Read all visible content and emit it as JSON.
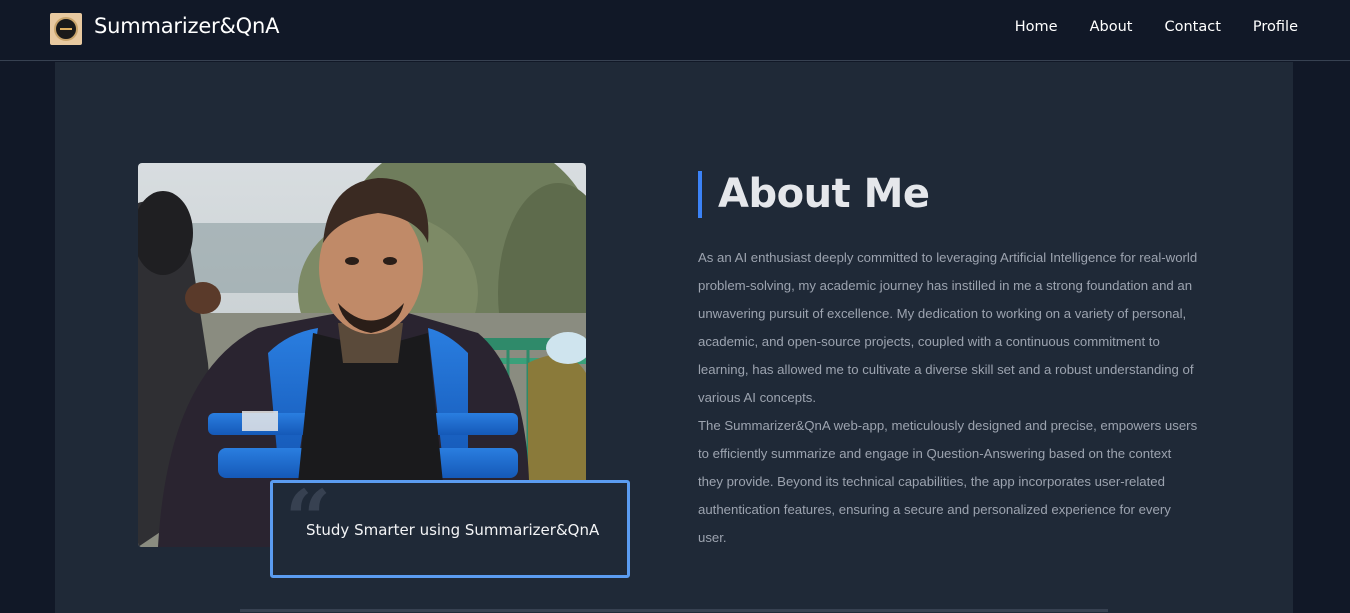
{
  "navbar": {
    "brand": "Summarizer&QnA",
    "links": [
      "Home",
      "About",
      "Contact",
      "Profile"
    ]
  },
  "about": {
    "heading": "About Me",
    "paragraph1": "As an AI enthusiast deeply committed to leveraging Artificial Intelligence for real-world problem-solving, my academic journey has instilled in me a strong foundation and an unwavering pursuit of excellence. My dedication to working on a variety of personal, academic, and open-source projects, coupled with a continuous commitment to learning, has allowed me to cultivate a diverse skill set and a robust understanding of various AI concepts.",
    "paragraph2": "The Summarizer&QnA web-app, meticulously designed and precise, empowers users to efficiently summarize and engage in Question-Answering based on the context they provide. Beyond its technical capabilities, the app incorporates user-related authentication features, ensuring a secure and personalized experience for every user."
  },
  "quote": {
    "text": "Study Smarter using Summarizer&QnA"
  },
  "colors": {
    "background": "#111827",
    "panel": "#1f2937",
    "accent": "#3b82f6",
    "quote_border": "#5b9cf0"
  },
  "icons": [
    "logo-icon",
    "quote-icon"
  ]
}
